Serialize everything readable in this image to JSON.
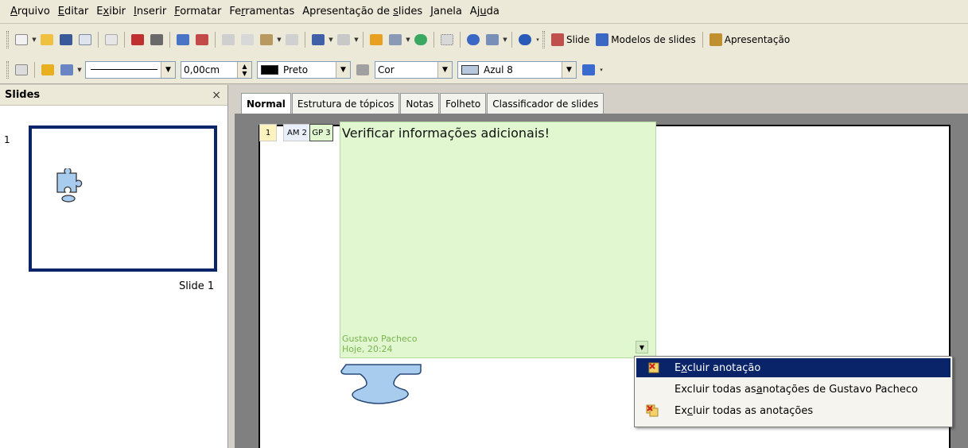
{
  "menubar": {
    "items": [
      {
        "pre": "",
        "u": "A",
        "post": "rquivo"
      },
      {
        "pre": "",
        "u": "E",
        "post": "ditar"
      },
      {
        "pre": "E",
        "u": "x",
        "post": "ibir"
      },
      {
        "pre": "",
        "u": "I",
        "post": "nserir"
      },
      {
        "pre": "",
        "u": "F",
        "post": "ormatar"
      },
      {
        "pre": "Fe",
        "u": "r",
        "post": "ramentas"
      },
      {
        "pre": "Apresentação de ",
        "u": "s",
        "post": "lides"
      },
      {
        "pre": "",
        "u": "J",
        "post": "anela"
      },
      {
        "pre": "Aj",
        "u": "u",
        "post": "da"
      }
    ]
  },
  "toolbar1": {
    "slide_label": "Slide",
    "models_label": "Modelos de slides",
    "presentation_label": "Apresentação"
  },
  "toolbar2": {
    "line_width": "0,00cm",
    "line_color": "Preto",
    "line_color_hex": "#000000",
    "area_style": "Cor",
    "area_color": "Azul 8",
    "area_color_hex": "#b4c7dc"
  },
  "slides_pane": {
    "title": "Slides",
    "close_glyph": "×",
    "slide_number": "1",
    "slide_label": "Slide 1"
  },
  "tabs": [
    "Normal",
    "Estrutura de tópicos",
    "Notas",
    "Folheto",
    "Classificador de slides"
  ],
  "annotation_markers": [
    "1",
    "AM 2",
    "GP 3"
  ],
  "note": {
    "text": "Verificar informações adicionais!",
    "author": "Gustavo Pacheco",
    "date": "Hoje, 20:24"
  },
  "context_menu": {
    "items": [
      {
        "pre": "E",
        "u": "x",
        "post": "cluir anotação",
        "icon": "delete-note-icon"
      },
      {
        "pre": "Excluir todas as ",
        "u": "a",
        "post": "notações de Gustavo Pacheco",
        "icon": ""
      },
      {
        "pre": "Ex",
        "u": "c",
        "post": "luir todas as anotações",
        "icon": "delete-all-notes-icon"
      }
    ]
  },
  "colors": {
    "note_bg": "#e0f7d0",
    "highlight": "#0a246a",
    "shape_fill": "#a8ccee"
  }
}
